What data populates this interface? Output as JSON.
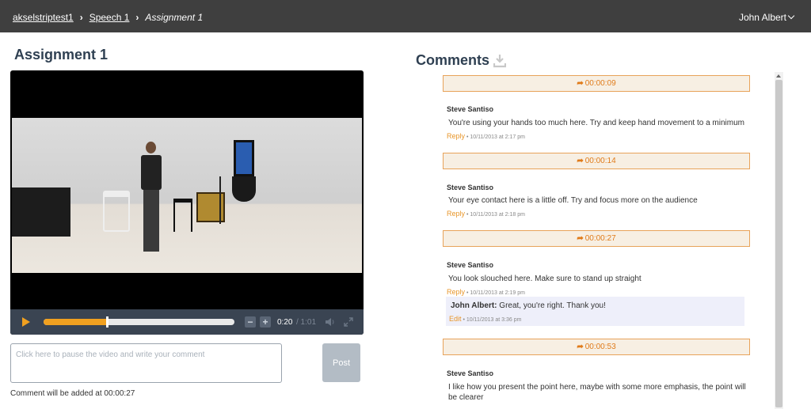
{
  "breadcrumb": {
    "items": [
      "akselstriptest1",
      "Speech 1"
    ],
    "current": "Assignment 1"
  },
  "user": {
    "name": "John Albert"
  },
  "page_title": "Assignment 1",
  "player": {
    "current_time": "0:20",
    "total_time": "/ 1:01",
    "progress": 0.33,
    "vol_minus": "−",
    "vol_plus": "+"
  },
  "composer": {
    "placeholder": "Click here to pause the video and write your comment",
    "post_label": "Post",
    "note": "Comment will be added at 00:00:27"
  },
  "comments_title": "Comments",
  "comments": [
    {
      "timestamp": "00:00:09",
      "author": "Steve Santiso",
      "text": "You're using your hands too much here. Try and keep hand movement to a minimum",
      "reply_label": "Reply",
      "date": "• 10/11/2013 at 2:17 pm"
    },
    {
      "timestamp": "00:00:14",
      "author": "Steve Santiso",
      "text": "Your eye contact here is a little off. Try and focus more on the audience",
      "reply_label": "Reply",
      "date": "• 10/11/2013 at 2:18 pm"
    },
    {
      "timestamp": "00:00:27",
      "author": "Steve Santiso",
      "text": "You look slouched here. Make sure to stand up straight",
      "reply_label": "Reply",
      "date": "• 10/11/2013 at 2:19 pm",
      "reply": {
        "author": "John Albert:",
        "text": "Great, you're right. Thank you!",
        "edit_label": "Edit",
        "date": "• 10/11/2013 at 3:36 pm"
      }
    },
    {
      "timestamp": "00:00:53",
      "author": "Steve Santiso",
      "text": "I like how you present the point here, maybe with some more emphasis, the point will be clearer"
    }
  ],
  "icons": {
    "timestamp": "share-arrow-icon",
    "download": "download-icon",
    "play": "play-icon",
    "speaker": "speaker-icon",
    "fullscreen": "fullscreen-icon"
  },
  "colors": {
    "topbar": "#3f3f3f",
    "accent": "#f0a020",
    "title": "#2f4052",
    "timestamp_bg": "#f7efe3",
    "timestamp_border": "#e8a35a",
    "reply_bg": "#eeeffa"
  }
}
